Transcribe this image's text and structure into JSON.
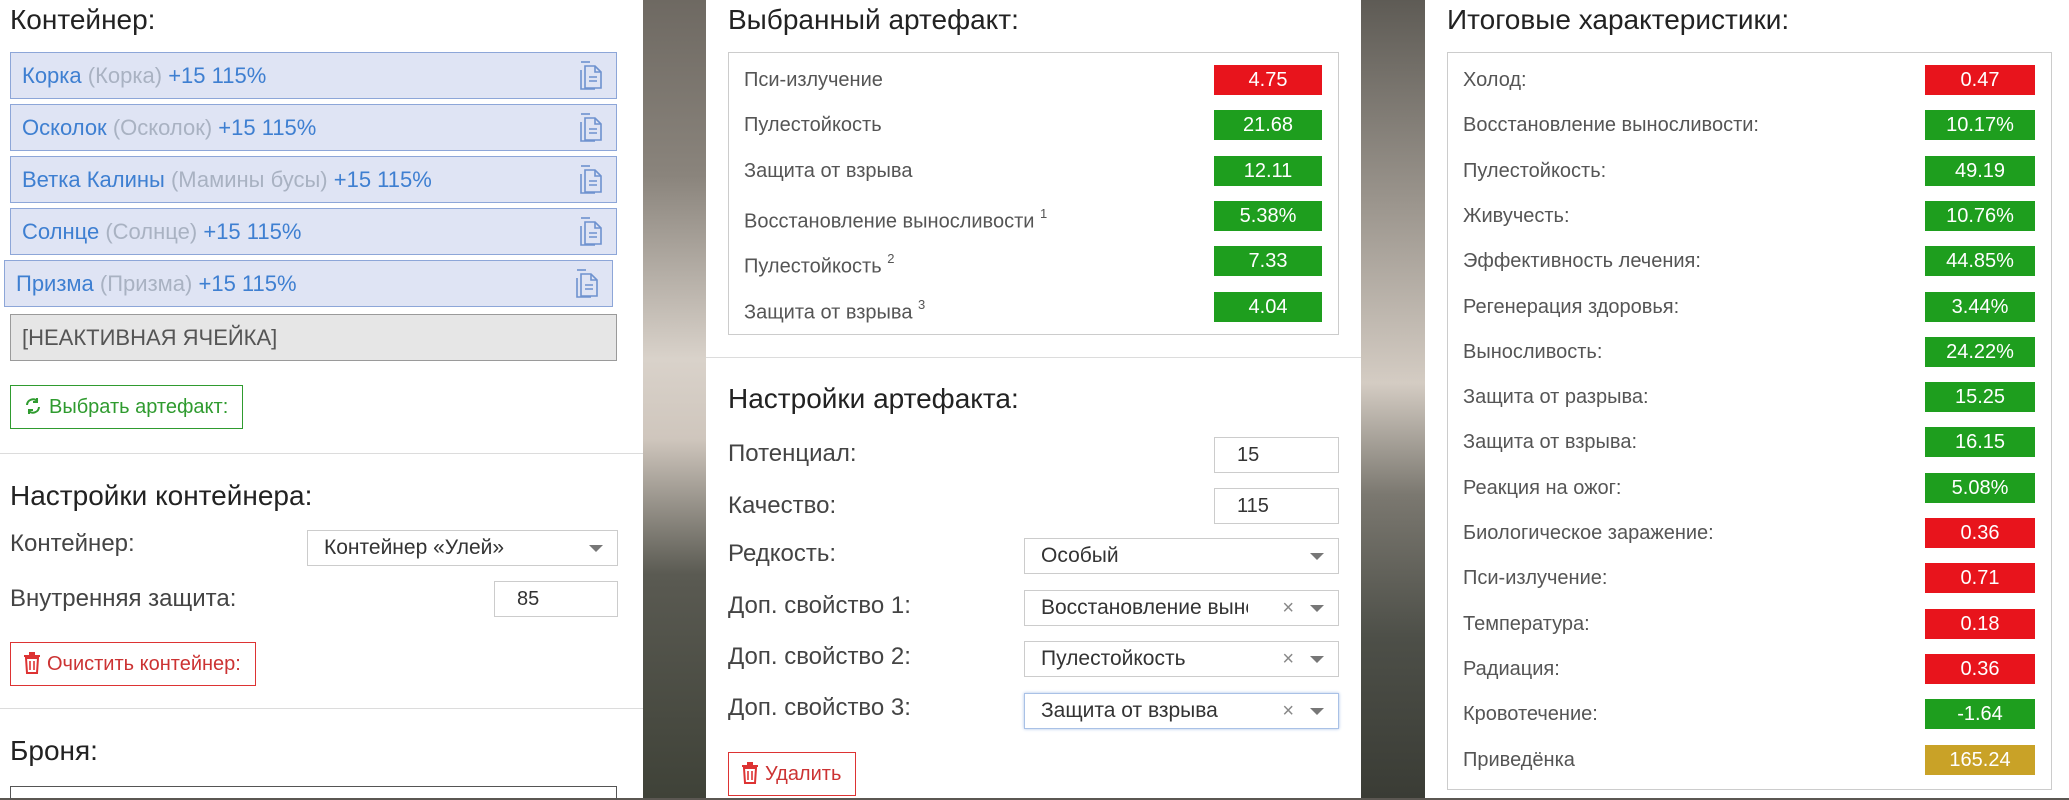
{
  "left": {
    "container_heading": "Контейнер:",
    "slots": [
      {
        "name": "Корка",
        "alt": "(Корка)",
        "bonus": "+15 115%"
      },
      {
        "name": "Осколок",
        "alt": "(Осколок)",
        "bonus": "+15 115%"
      },
      {
        "name": "Ветка Калины",
        "alt": "(Мамины бусы)",
        "bonus": "+15 115%"
      },
      {
        "name": "Солнце",
        "alt": "(Солнце)",
        "bonus": "+15 115%"
      },
      {
        "name": "Призма",
        "alt": "(Призма)",
        "bonus": "+15 115%"
      }
    ],
    "inactive_slot": "[НЕАКТИВНАЯ ЯЧЕЙКА]",
    "choose_button": "Выбрать артефакт:",
    "settings_heading": "Настройки контейнера:",
    "container_label": "Контейнер:",
    "container_value": "Контейнер «Улей»",
    "protection_label": "Внутренняя защита:",
    "protection_value": "85",
    "clear_button": "Очистить контейнер:",
    "armor_heading": "Броня:"
  },
  "mid": {
    "selected_heading": "Выбранный артефакт:",
    "stats": [
      {
        "name": "Пси-излучение",
        "sup": "",
        "value": "4.75",
        "color": "red"
      },
      {
        "name": "Пулестойкость",
        "sup": "",
        "value": "21.68",
        "color": "green"
      },
      {
        "name": "Защита от взрыва",
        "sup": "",
        "value": "12.11",
        "color": "green"
      },
      {
        "name": "Восстановление выносливости",
        "sup": "1",
        "value": "5.38%",
        "color": "green"
      },
      {
        "name": "Пулестойкость",
        "sup": "2",
        "value": "7.33",
        "color": "green"
      },
      {
        "name": "Защита от взрыва",
        "sup": "3",
        "value": "4.04",
        "color": "green"
      }
    ],
    "settings_heading": "Настройки артефакта:",
    "potential_label": "Потенциал:",
    "potential_value": "15",
    "quality_label": "Качество:",
    "quality_value": "115",
    "rarity_label": "Редкость:",
    "rarity_value": "Особый",
    "prop1_label": "Доп. свойство 1:",
    "prop1_value": "Восстановление выносливости",
    "prop2_label": "Доп. свойство 2:",
    "prop2_value": "Пулестойкость",
    "prop3_label": "Доп. свойство 3:",
    "prop3_value": "Защита от взрыва",
    "clear_glyph": "×",
    "delete_button": "Удалить"
  },
  "right": {
    "heading": "Итоговые характеристики:",
    "stats": [
      {
        "name": "Холод:",
        "value": "0.47",
        "color": "red"
      },
      {
        "name": "Восстановление выносливости:",
        "value": "10.17%",
        "color": "green"
      },
      {
        "name": "Пулестойкость:",
        "value": "49.19",
        "color": "green"
      },
      {
        "name": "Живучесть:",
        "value": "10.76%",
        "color": "green"
      },
      {
        "name": "Эффективность лечения:",
        "value": "44.85%",
        "color": "green"
      },
      {
        "name": "Регенерация здоровья:",
        "value": "3.44%",
        "color": "green"
      },
      {
        "name": "Выносливость:",
        "value": "24.22%",
        "color": "green"
      },
      {
        "name": "Защита от разрыва:",
        "value": "15.25",
        "color": "green"
      },
      {
        "name": "Защита от взрыва:",
        "value": "16.15",
        "color": "green"
      },
      {
        "name": "Реакция на ожог:",
        "value": "5.08%",
        "color": "green"
      },
      {
        "name": "Биологическое заражение:",
        "value": "0.36",
        "color": "red"
      },
      {
        "name": "Пси-излучение:",
        "value": "0.71",
        "color": "red"
      },
      {
        "name": "Температура:",
        "value": "0.18",
        "color": "red"
      },
      {
        "name": "Радиация:",
        "value": "0.36",
        "color": "red"
      },
      {
        "name": "Кровотечение:",
        "value": "-1.64",
        "color": "green"
      },
      {
        "name": "Приведёнка",
        "value": "165.24",
        "color": "gold"
      }
    ]
  },
  "colors": {
    "red": "#e8141c",
    "green": "#1e9e1e",
    "gold": "#c9a227",
    "slot_text": "#3e7fd1"
  }
}
